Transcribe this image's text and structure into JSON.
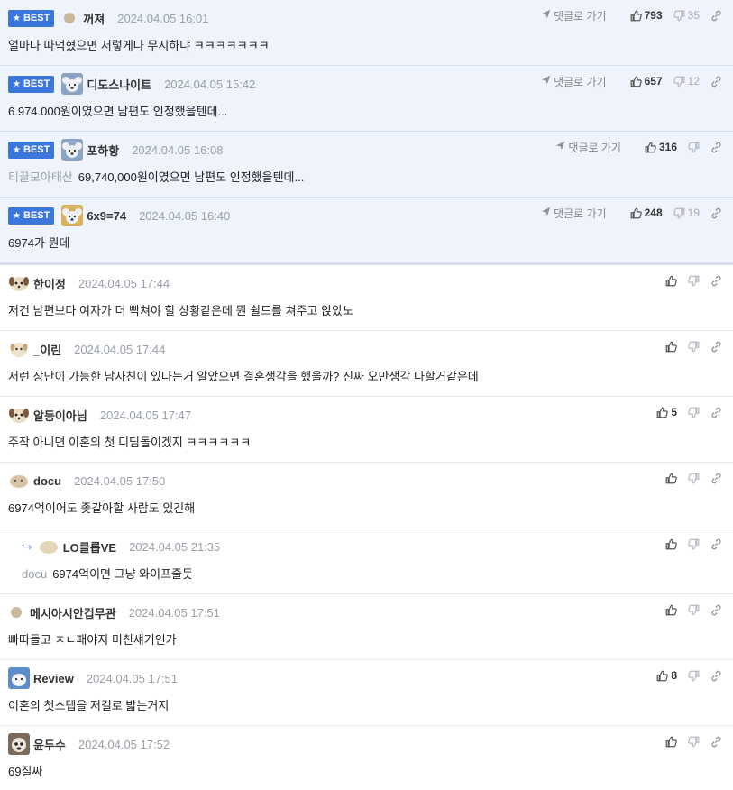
{
  "colors": {
    "best_bg": "#eef3fc",
    "badge": "#3a76dc",
    "date": "#9aa0a8"
  },
  "labels": {
    "best": "BEST",
    "goto": "댓글로 가기"
  },
  "best_comments": [
    {
      "nick": "꺼져",
      "date": "2024.04.05 16:01",
      "text": "얼마나 따먹혔으면 저렇게나 무시하냐 ㅋㅋㅋㅋㅋㅋㅋ",
      "quote": "",
      "likes": "793",
      "dislikes": "35",
      "avatar": "circle"
    },
    {
      "nick": "디도스나이트",
      "date": "2024.04.05 15:42",
      "text": "6.974.000원이였으면 남편도 인정했을텐데...",
      "quote": "",
      "likes": "657",
      "dislikes": "12",
      "avatar": "koala"
    },
    {
      "nick": "포하항",
      "date": "2024.04.05 16:08",
      "text": "69,740,000원이였으면 남편도 인정했을텐데...",
      "quote": "티끌모아태산",
      "likes": "316",
      "dislikes": "",
      "avatar": "koala"
    },
    {
      "nick": "6x9=74",
      "date": "2024.04.05 16:40",
      "text": "6974가 뭔데",
      "quote": "",
      "likes": "248",
      "dislikes": "19",
      "avatar": "koala-gold"
    }
  ],
  "comments": [
    {
      "nick": "한이정",
      "date": "2024.04.05 17:44",
      "text": "저건 남편보다 여자가 더 빡쳐야 할 상황같은데 뭔 쉴드를 쳐주고 앉았노",
      "quote": "",
      "likes": "",
      "reply": false,
      "avatar": "dog"
    },
    {
      "nick": "_이린",
      "date": "2024.04.05 17:44",
      "text": "저런 장난이 가능한 남사친이 있다는거 알았으면 결혼생각을 했을까? 진짜 오만생각 다할거같은데",
      "quote": "",
      "likes": "",
      "reply": false,
      "avatar": "dog-light"
    },
    {
      "nick": "알등이아님",
      "date": "2024.04.05 17:47",
      "text": "주작 아니면 이혼의 첫 디딤돌이겠지 ㅋㅋㅋㅋㅋㅋ",
      "quote": "",
      "likes": "5",
      "reply": false,
      "avatar": "dog"
    },
    {
      "nick": "docu",
      "date": "2024.04.05 17:50",
      "text": "6974억이어도 좆같아할 사람도 있긴해",
      "quote": "",
      "likes": "",
      "reply": false,
      "avatar": "blob"
    },
    {
      "nick": "LO클롭VE",
      "date": "2024.04.05 21:35",
      "text": "6974억이면 그냥 와이프줄듯",
      "quote": "docu",
      "likes": "",
      "reply": true,
      "avatar": "blob-light"
    },
    {
      "nick": "메시아시안컵무관",
      "date": "2024.04.05 17:51",
      "text": "빠따들고 ㅈㄴ패야지 미친섀기인가",
      "quote": "",
      "likes": "",
      "reply": false,
      "avatar": "circle"
    },
    {
      "nick": "Review",
      "date": "2024.04.05 17:51",
      "text": "이혼의 첫스텝을 저걸로 밟는거지",
      "quote": "",
      "likes": "8",
      "reply": false,
      "avatar": "polar"
    },
    {
      "nick": "윤두수",
      "date": "2024.04.05 17:52",
      "text": "69질싸",
      "quote": "",
      "likes": "",
      "reply": false,
      "avatar": "pug"
    }
  ]
}
